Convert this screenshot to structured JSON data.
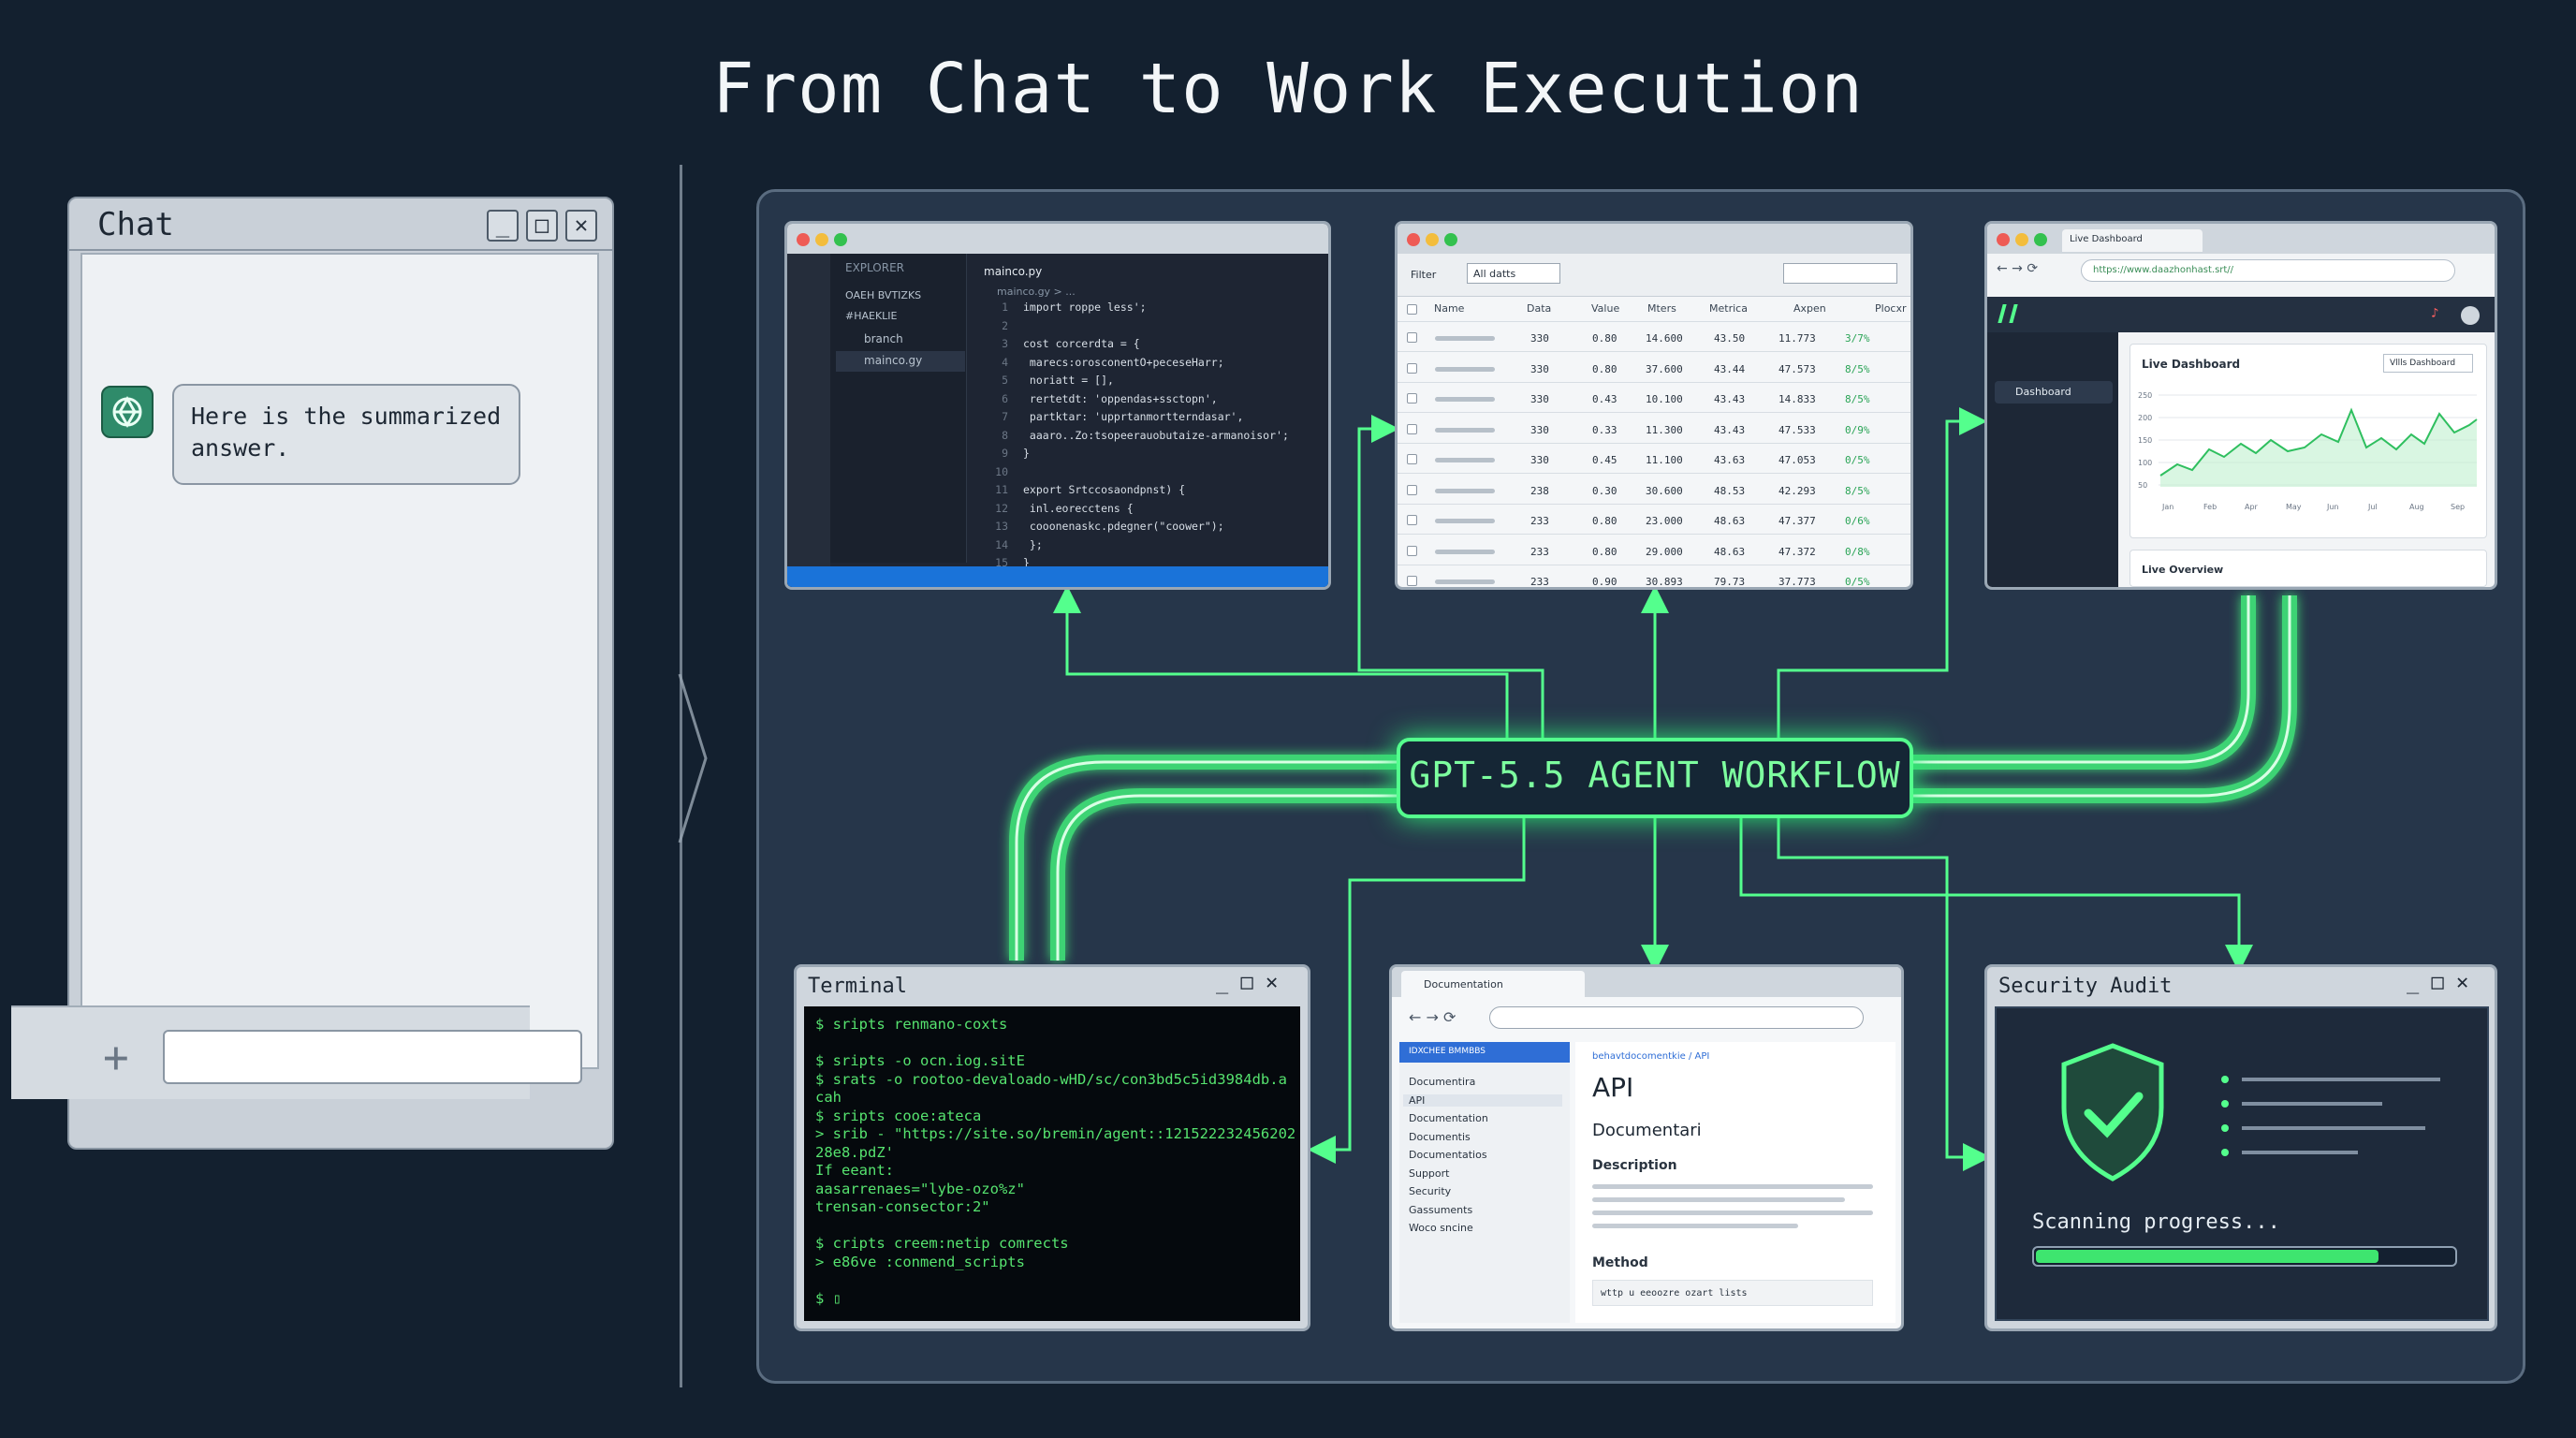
{
  "title": "From Chat to Work Execution",
  "chat": {
    "window_title": "Chat",
    "message": "Here is the summarized answer.",
    "input_placeholder": "",
    "buttons": {
      "minimize": "_",
      "maximize": "□",
      "close": "✕"
    }
  },
  "workflow_label": "GPT-5.5 AGENT WORKFLOW",
  "code_editor": {
    "tab": "mainco.py",
    "explorer_header": "EXPLORER",
    "explorer_items": [
      "OAEH BVTIZKS",
      "#HAEKLIE",
      "branch",
      "mainco.gy"
    ],
    "breadcrumb": "mainco.gy > ...",
    "lines": [
      "import roppe less';",
      "",
      "cost corcerdta = {",
      "  marecs:orosconentO+peceseHarr;",
      "  noriatt = [],",
      "  rertetdt: 'oppendas+ssctopn',",
      "  partktar: 'upprtanmortterndasar',",
      "  aaaro..Zo:tsopeerauobutaize-armanoisor';",
      "}",
      "",
      "export Srtccosaondpnst) {",
      "  inl.eorecctens {",
      "    cooonenaskc.pdegner(\"coower\");",
      "  };",
      "}",
      ""
    ]
  },
  "data_table": {
    "filter_label": "Filter",
    "filter_value": "All datts",
    "columns": [
      "Name",
      "Data",
      "Value",
      "Mters",
      "Metrica",
      "Axpen",
      "Plocxr"
    ],
    "rows": [
      [
        "330",
        "0.80",
        "14.600",
        "43.50",
        "11.773",
        "3/7%"
      ],
      [
        "330",
        "0.80",
        "37.600",
        "43.44",
        "47.573",
        "8/5%"
      ],
      [
        "330",
        "0.43",
        "10.100",
        "43.43",
        "14.833",
        "8/5%"
      ],
      [
        "330",
        "0.33",
        "11.300",
        "43.43",
        "47.533",
        "0/9%"
      ],
      [
        "330",
        "0.45",
        "11.100",
        "43.63",
        "47.053",
        "0/5%"
      ],
      [
        "238",
        "0.30",
        "30.600",
        "48.53",
        "42.293",
        "8/5%"
      ],
      [
        "233",
        "0.80",
        "23.000",
        "48.63",
        "47.377",
        "0/6%"
      ],
      [
        "233",
        "0.80",
        "29.000",
        "48.63",
        "47.372",
        "0/8%"
      ],
      [
        "233",
        "0.90",
        "30.893",
        "79.73",
        "37.773",
        "0/5%"
      ]
    ]
  },
  "dashboard": {
    "tab": "Live Dashboard",
    "url": "https://www.daazhonhast.srt//",
    "nav_item": "Dashboard",
    "card_title": "Live Dashboard",
    "select_value": "Vllls Dashboard",
    "y_ticks": [
      "250",
      "200",
      "150",
      "100",
      "50"
    ],
    "x_ticks": [
      "Jan",
      "Feb",
      "Apr",
      "May",
      "Jun",
      "Jul",
      "Aug",
      "Sep"
    ],
    "overview_title": "Live Overview"
  },
  "terminal": {
    "window_title": "Terminal",
    "lines": [
      "$ sripts renmano-coxts",
      "",
      "$ sripts -o ocn.iog.sitE",
      "$ srats -o rootoo-devaloado-wHD/sc/con3bd5c5id3984db.a",
      "cah",
      "$ sripts cooe:ateca",
      "> srib - \"https://site.so/bremin/agent::121522232456202",
      "28e8.pdZ'",
      "If eeant:",
      "  aasarrenaes=\"lybe-ozo%z\"",
      "  trensan-consector:2\"",
      "",
      "$ cripts creem:netip comrects",
      "> e86ve :conmend_scripts",
      "",
      "$ ▯"
    ]
  },
  "documentation": {
    "tab": "Documentation",
    "section_header": "IDXCHEE BMMBBS",
    "nav_items": [
      "Documentira",
      "API",
      "Documentation",
      "Documentis",
      "Documentatios",
      "Support",
      "Security",
      "Gassuments",
      "Woco sncine"
    ],
    "breadcrumb": "behavtdocomentkie / API",
    "heading": "API",
    "subheading": "Documentari",
    "description_label": "Description",
    "method_label": "Method",
    "method_code": "wttp u eeoozre ozart lists"
  },
  "security": {
    "window_title": "Security Audit",
    "status_text": "Scanning progress...",
    "progress": 0.82
  },
  "colors": {
    "background": "#13202f",
    "panel": "#26364a",
    "neon": "#54ff8d",
    "terminal_text": "#56e36f",
    "editor_status": "#1a73d9"
  }
}
